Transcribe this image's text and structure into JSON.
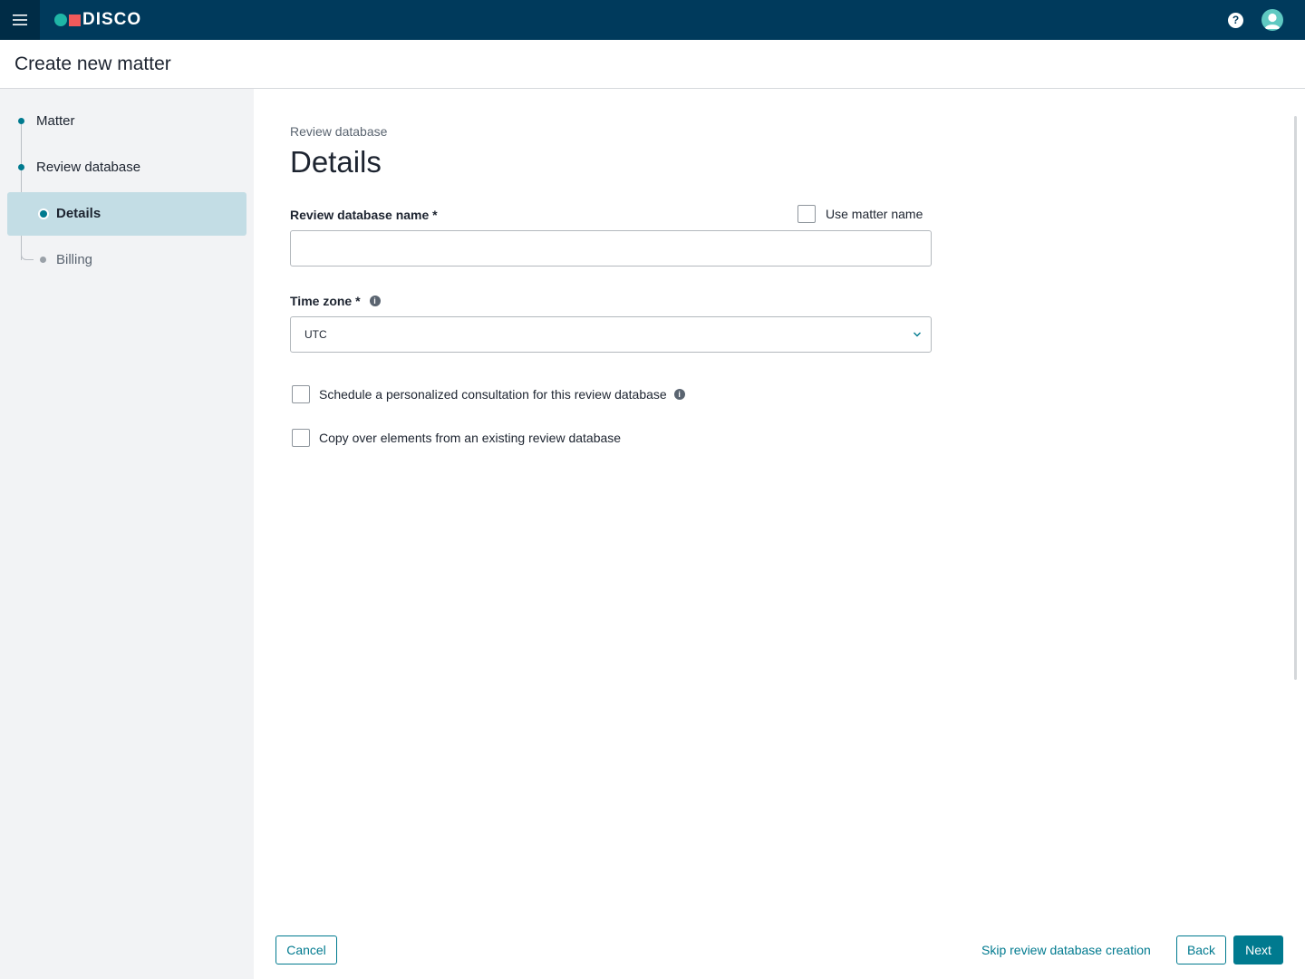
{
  "app": {
    "brand": "DISCO",
    "help_glyph": "?",
    "colors": {
      "topbar": "#003a5c",
      "accent": "#007a8f",
      "logo_dot": "#1fb5a6",
      "logo_square": "#f05a5b"
    },
    "icons": [
      "menu-icon",
      "help-icon",
      "avatar-icon",
      "info-icon",
      "chevron-down-icon"
    ]
  },
  "page": {
    "title": "Create new matter"
  },
  "sidebar": {
    "steps": [
      {
        "label": "Matter"
      },
      {
        "label": "Review database"
      },
      {
        "label": "Details"
      },
      {
        "label": "Billing"
      }
    ]
  },
  "main": {
    "breadcrumb": "Review database",
    "title": "Details",
    "name_field": {
      "label": "Review database name *",
      "value": "",
      "placeholder": ""
    },
    "use_matter_name": {
      "label": "Use matter name",
      "checked": false
    },
    "timezone": {
      "label": "Time zone *",
      "value": "UTC",
      "info_glyph": "i"
    },
    "consultation": {
      "label": "Schedule a personalized consultation for this review database",
      "checked": false
    },
    "copy_elements": {
      "label": "Copy over elements from an existing review database",
      "checked": false
    }
  },
  "footer": {
    "cancel": "Cancel",
    "skip": "Skip review database creation",
    "back": "Back",
    "next": "Next"
  }
}
